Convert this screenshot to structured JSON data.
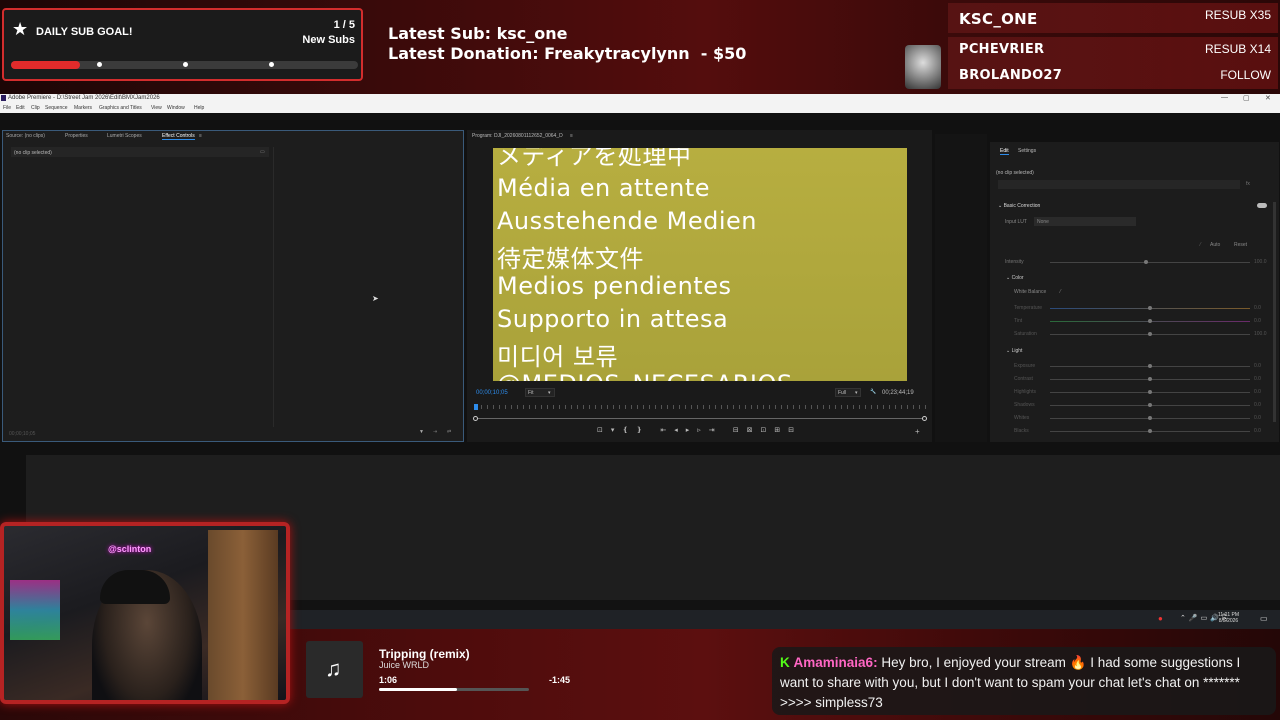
{
  "overlay": {
    "goal": {
      "title": "DAILY SUB GOAL!",
      "count": "1 / 5",
      "unit": "New Subs",
      "progress": 0.2
    },
    "latest_sub": "Latest Sub: ksc_one",
    "latest_donation": "Latest Donation: Freakytracylynn  - $50",
    "events": [
      {
        "name": "KSC_ONE",
        "tag": "RESUB X35"
      },
      {
        "name": "PCHEVRIER",
        "tag": "RESUB X14"
      },
      {
        "name": "BROLANDO27",
        "tag": "FOLLOW"
      }
    ]
  },
  "window": {
    "title": "Adobe Premiere - D:\\Street Jam 2026\\Edit\\BMXJam2026",
    "controls": [
      "—",
      "▢",
      "✕"
    ]
  },
  "menu": [
    "File",
    "Edit",
    "Clip",
    "Sequence",
    "Markers",
    "Graphics and Titles",
    "View",
    "Window",
    "Help"
  ],
  "source_panel": {
    "tabs": [
      "Source: (no clips)",
      "Properties",
      "Lumetri Scopes",
      "Effect Controls"
    ],
    "no_clip": "(no clip selected)",
    "timecode": "00;00;10;05"
  },
  "program_panel": {
    "tab": "Program: DJI_20260801112652_0064_D",
    "media_lines": [
      "メディアを処理中",
      "Média en attente",
      "Ausstehende Medien",
      "待定媒体文件",
      "Medios pendientes",
      "Supporto in attesa",
      "미디어 보류",
      "@MEDIOS_NECESARIOS"
    ],
    "timecode_left": "00;00;10;05",
    "fit": "Fit",
    "full": "Full",
    "timecode_right": "00;23;44;19"
  },
  "lumetri": {
    "tabs": [
      "Edit",
      "Settings"
    ],
    "no_clip": "(no clip selected)",
    "basic_correction": "Basic Correction",
    "input_lut": "Input LUT",
    "input_lut_value": "None",
    "auto": "Auto",
    "reset": "Reset",
    "intensity": "Intensity",
    "color": "Color",
    "white_balance": "White Balance",
    "light": "Light",
    "color_rows": [
      "Temperature",
      "Tint",
      "Saturation"
    ],
    "light_rows": [
      "Exposure",
      "Contrast",
      "Highlights",
      "Shadows",
      "Whites",
      "Blacks"
    ],
    "zero": "0.0",
    "hundred": "100.0"
  },
  "taskbar": {
    "time": "11:01 PM",
    "date": "8/5/2026"
  },
  "webcam": {
    "sign": "@sclinton"
  },
  "song": {
    "title": "Tripping (remix)",
    "artist": "Juice WRLD",
    "current": "1:06",
    "remaining": "-1:45",
    "progress": 0.52
  },
  "chat": {
    "user": "Amaminaia6",
    "separator": ":",
    "message": "Hey bro, I enjoyed your stream 🔥 I had some suggestions I want to share with you, but I don't want to spam your chat let's chat on ******* >>>> simpless73"
  },
  "colors": {
    "accent_red": "#d32d2d",
    "premiere_blue": "#2d8ceb",
    "chat_user": "#ff66c4",
    "kick_green": "#53fc18"
  }
}
